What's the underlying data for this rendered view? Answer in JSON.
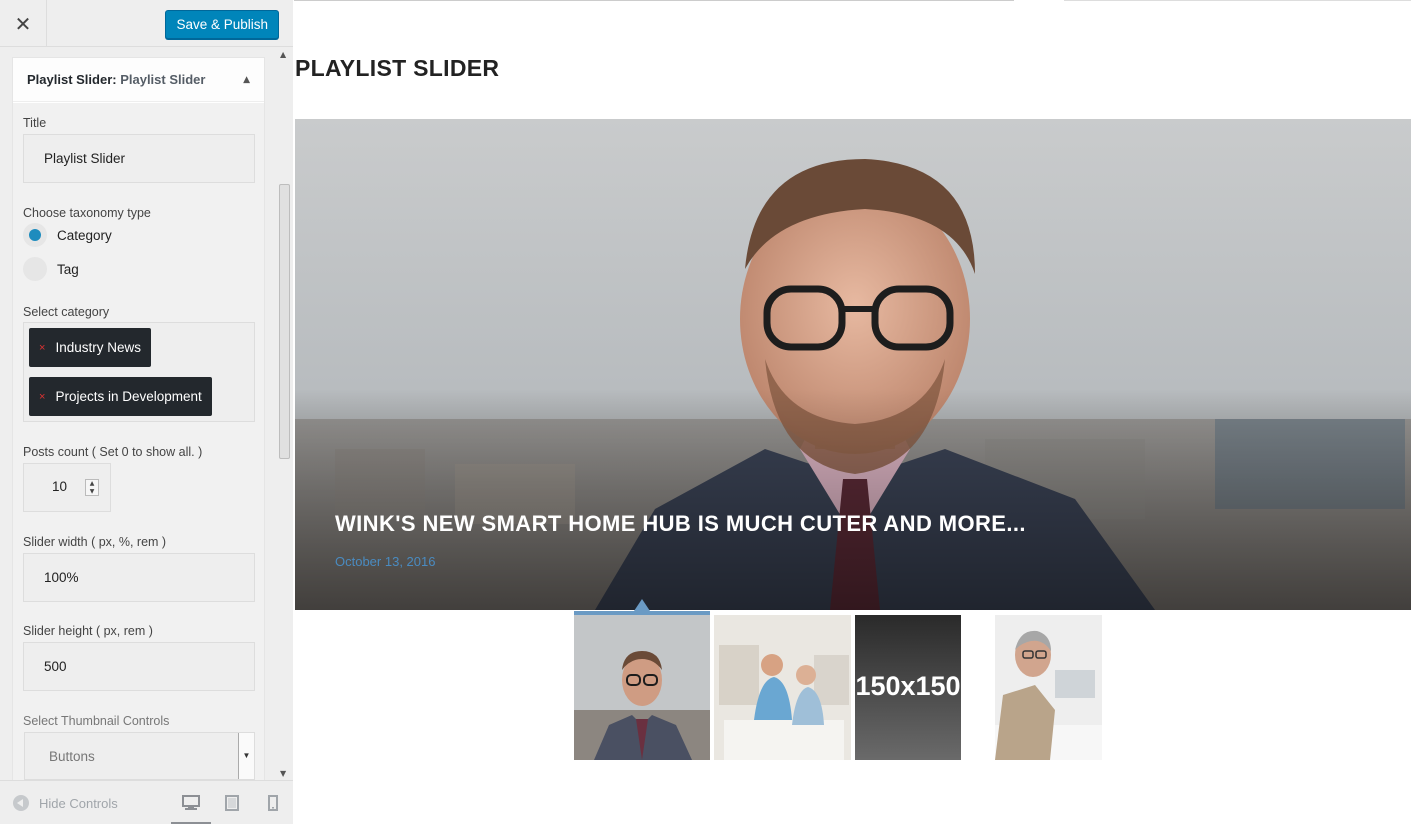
{
  "topbar": {
    "close_label": "✕",
    "publish_label": "Save & Publish"
  },
  "panel": {
    "title_bold": "Playlist Slider:",
    "title_name": " Playlist Slider",
    "toggle_glyph": "▲"
  },
  "form": {
    "title_label": "Title",
    "title_value": "Playlist Slider",
    "taxonomy_label": "Choose taxonomy type",
    "taxonomy_options": [
      "Category",
      "Tag"
    ],
    "taxonomy_selected": "Category",
    "category_label": "Select category",
    "categories": [
      "Industry News",
      "Projects in Development"
    ],
    "chip_remove_glyph": "×",
    "posts_count_label": "Posts count ( Set 0 to show all. )",
    "posts_count_value": "10",
    "slider_width_label": "Slider width ( px, %, rem )",
    "slider_width_value": "100%",
    "slider_height_label": "Slider height ( px, rem )",
    "slider_height_value": "500",
    "thumb_controls_label": "Select Thumbnail Controls",
    "thumb_controls_value": "Buttons"
  },
  "footer": {
    "hide_controls_label": "Hide Controls",
    "devices": [
      "desktop-icon",
      "tablet-icon",
      "mobile-icon"
    ],
    "active_device": "desktop"
  },
  "preview": {
    "widget_title": "PLAYLIST SLIDER",
    "slide_title": "WINK'S NEW SMART HOME HUB IS MUCH CUTER AND MORE...",
    "slide_date": "October 13, 2016",
    "placeholder_thumb_text": "150x150"
  },
  "colors": {
    "publish_button": "#0085ba",
    "radio_checked": "#1e8cbe",
    "chip_bg": "#23282d",
    "chip_remove": "#dc3232",
    "date_link": "#4a8bc0",
    "active_thumb_bar": "#6a9ac4"
  }
}
